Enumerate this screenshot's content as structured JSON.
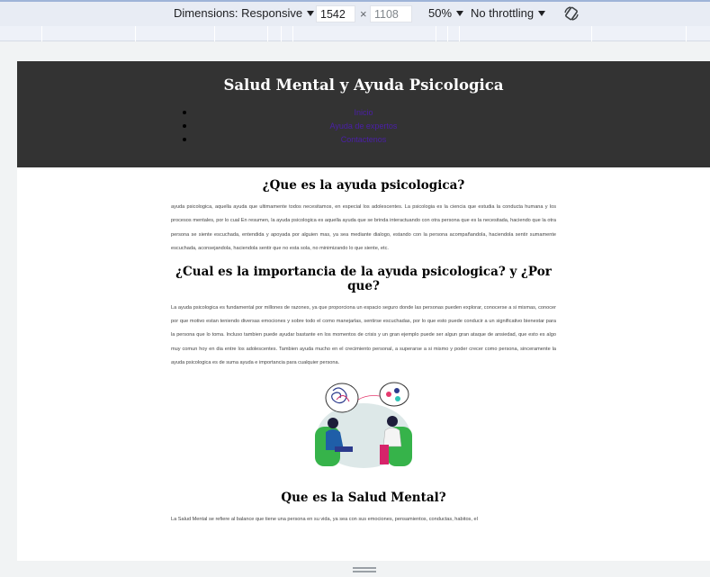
{
  "devtools": {
    "dimensions_label": "Dimensions: Responsive",
    "width_value": "1542",
    "times": "×",
    "height_value": "1108",
    "zoom": "50%",
    "throttling": "No throttling",
    "rotate_icon": "rotate-icon"
  },
  "site": {
    "title": "Salud Mental y Ayuda Psicologica",
    "nav": [
      "Inicio",
      "Ayuda de expertos",
      "Contactenos"
    ]
  },
  "sections": [
    {
      "title": "¿Que es la ayuda psicologica?",
      "text": "ayuda psicologica, aquella ayuda que ultimamente todos necesitamos, en especial los adolescentes. La psicologia es la ciencia que estudia la conducta humana y los procesos mentales, por lo cual En resumen, la ayuda psicologica es aquella ayuda que se brinda interactuando con otra persona que es la necesitada, haciendo que la otra persona se siente escuchada, entendida y apoyada por alguien mas, ya sea mediante dialogo, estando con la persona acompañandola, haciendola sentir sumamente escuchada, aconsejandola, haciendola sentir que no esta sola, no minimizando lo que siente, etc."
    },
    {
      "title": "¿Cual es la importancia de la ayuda psicologica? y ¿Por que?",
      "text": "La ayuda psicologica es fundamental por millones de razones, ya que proporciona un espacio seguro donde las personas pueden explorar, conocerse a si mismas, conocer por que motivo estan teniendo diversas emociones y sobre todo el como manejarlas, sentirse escuchadas, por lo que esto puede conducir a un significativo bienestar para la persona que lo toma. Incluso tambien puede ayudar bastante en los momentos de crisis y un gran ejemplo puede ser algun gran ataque de ansiedad, que esto es algo muy comun hoy en dia entre los adolescentes. Tambien ayuda mucho en el crecimiento personal, a superarse a si mismo y poder crecer como persona, sinceramente la ayuda psicologica es de suma ayuda e importancia para cualquier persona."
    },
    {
      "title": "Que es la Salud Mental?",
      "text": "La Salud Mental se refiere al balance que tiene una persona en su vida, ya sea con sus emociones, pensamientos, conductas, habitos, el"
    }
  ],
  "colors": {
    "header_bg": "#333333",
    "nav_link": "#4b1fa8",
    "devtools_bg": "#e8ecf4"
  }
}
